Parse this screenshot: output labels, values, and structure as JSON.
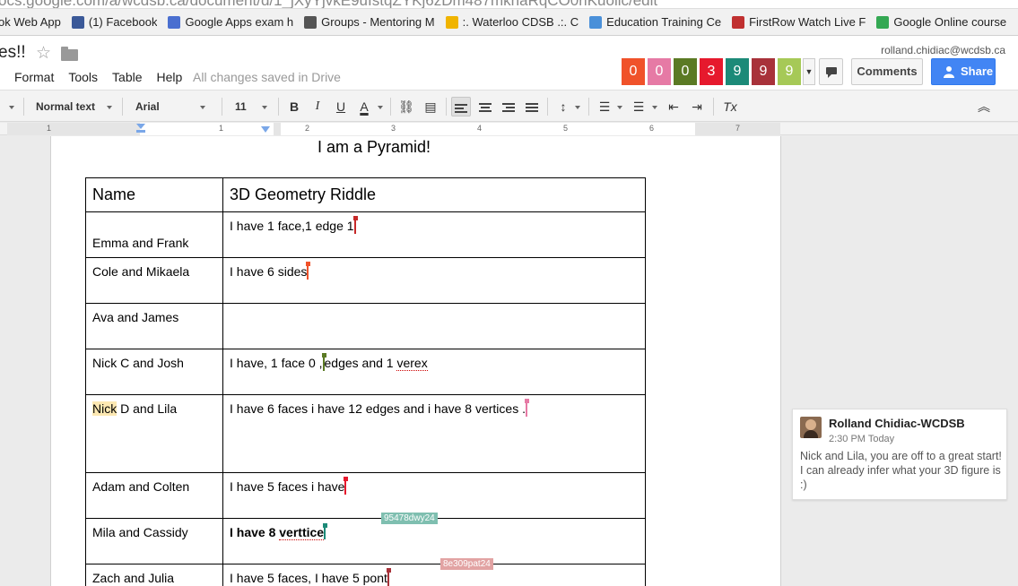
{
  "browser": {
    "url_domain": "ocs.google.com",
    "url_path": "/a/wcdsb.ca/document/d/1_jXyYjvkE9uIstqZYKj6zDm487mkhaRqCO0rlKuolic/edit"
  },
  "bookmarks": [
    {
      "label": "ok Web App",
      "icon_color": "#3b5998"
    },
    {
      "label": "(1) Facebook",
      "icon_color": "#3b5998"
    },
    {
      "label": "Google Apps exam h",
      "icon_color": "#4a6fd0"
    },
    {
      "label": "Groups - Mentoring M",
      "icon_color": "#555555"
    },
    {
      "label": ":. Waterloo CDSB .:. C",
      "icon_color": "#f0b400"
    },
    {
      "label": "Education Training Ce",
      "icon_color": "#4a90d9"
    },
    {
      "label": "FirstRow Watch Live F",
      "icon_color": "#c03030"
    },
    {
      "label": "Google Online course",
      "icon_color": "#34a853"
    }
  ],
  "doc": {
    "title": "es!!",
    "menus": [
      "Format",
      "Tools",
      "Table",
      "Help"
    ],
    "saved_status": "All changes saved in Drive",
    "account_email": "rolland.chidiac@wcdsb.ca",
    "comments_label": "Comments",
    "share_label": "Share"
  },
  "collaborators": [
    {
      "initial": "0",
      "color": "#f0522a"
    },
    {
      "initial": "0",
      "color": "#e67aa5"
    },
    {
      "initial": "0",
      "color": "#5b7a24"
    },
    {
      "initial": "3",
      "color": "#e6192d"
    },
    {
      "initial": "9",
      "color": "#1c8a78"
    },
    {
      "initial": "9",
      "color": "#a8323a"
    },
    {
      "initial": "9",
      "color": "#a6c957"
    }
  ],
  "toolbar": {
    "style": "Normal text",
    "font": "Arial",
    "size": "11",
    "bold": "B",
    "italic": "I",
    "underline": "U",
    "text_color": "A",
    "clear_format": "Tx"
  },
  "ruler": {
    "numbers": [
      "1",
      "1",
      "2",
      "3",
      "4",
      "5",
      "6",
      "7"
    ]
  },
  "document": {
    "heading": "I am a Pyramid!",
    "table": {
      "headers": [
        "Name",
        "3D Geometry Riddle"
      ],
      "rows": [
        {
          "name": "Emma and Frank",
          "riddle": "I have 1 face,1 edge 1"
        },
        {
          "name": "Cole and Mikaela",
          "riddle": "I have 6 sides"
        },
        {
          "name": "Ava and James",
          "riddle": ""
        },
        {
          "name": "Nick C and Josh",
          "riddle_a": "I have, 1 face 0 ,",
          "riddle_b": "edges and 1 ",
          "riddle_c": "verex"
        },
        {
          "name_hl": "Nick",
          "name_rest": " D and Lila",
          "riddle": "I have 6 faces i have 12 edges and i have 8 vertices ."
        },
        {
          "name": "Adam and Colten",
          "riddle": "I have 5 faces i have"
        },
        {
          "name": "Mila and Cassidy",
          "riddle_a": "I have 8 ",
          "riddle_b": "verttice"
        },
        {
          "name": "Zach and Julia",
          "riddle": "I have 5 faces, I have 5 pont"
        }
      ]
    },
    "cursor_tags": [
      {
        "label": "95478dwy24",
        "color": "#7fbfb0"
      },
      {
        "label": "8e309pat24",
        "color": "#e2a3a3"
      }
    ]
  },
  "comment": {
    "author": "Rolland Chidiac-WCDSB",
    "time": "2:30 PM Today",
    "body": "Nick and Lila, you are off to a great start! I can already infer what your 3D figure is :)"
  }
}
